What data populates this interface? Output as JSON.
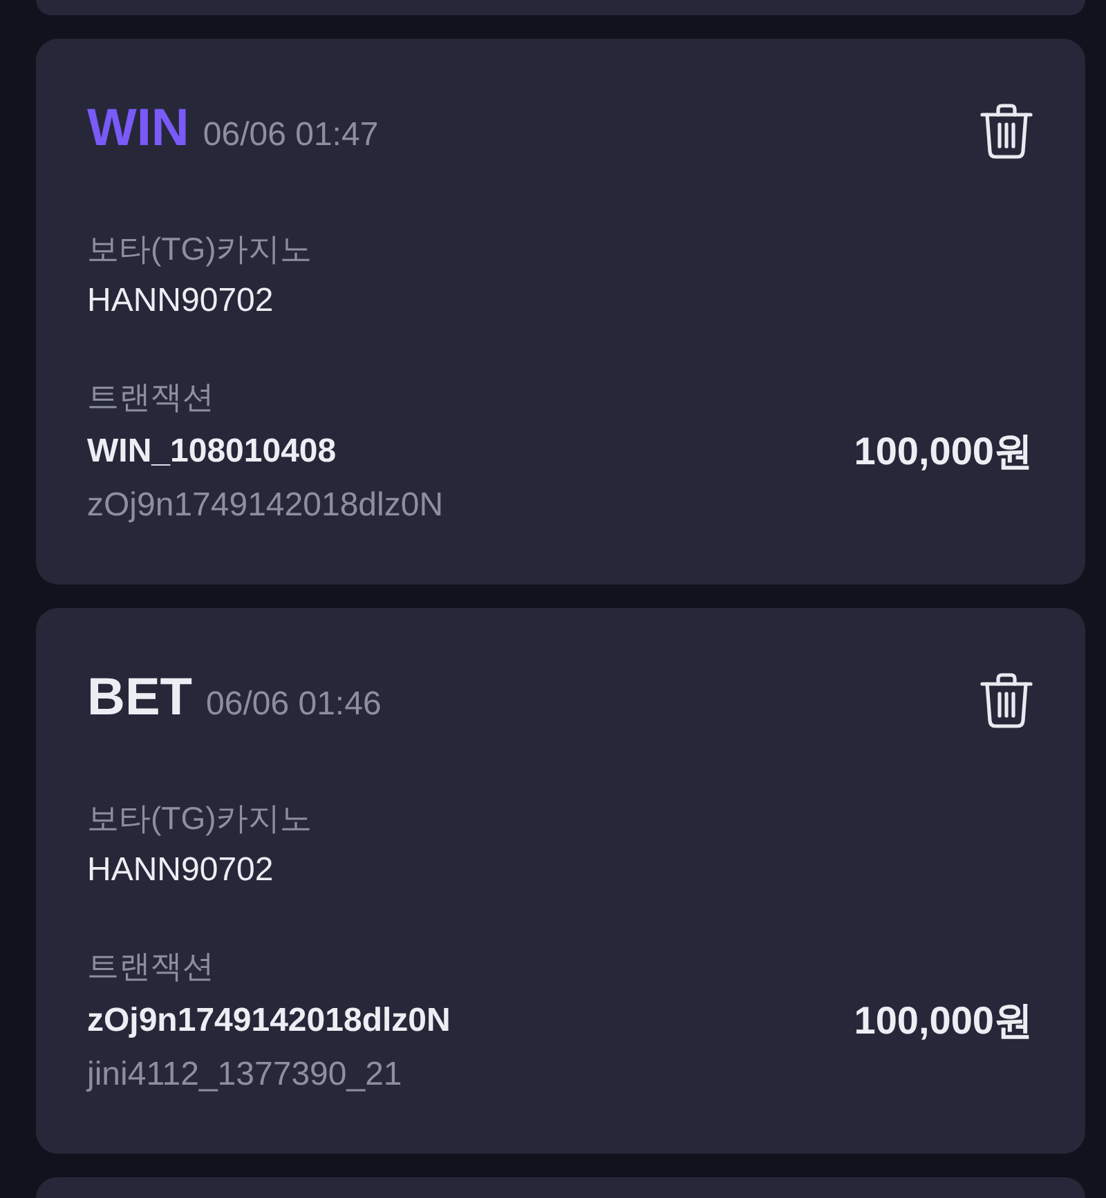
{
  "transactions": [
    {
      "kind": "win",
      "type": "WIN",
      "time": "06/06 01:47",
      "provider": "보타(TG)카지노",
      "user": "HANN90702",
      "transaction_label": "트랜잭션",
      "transaction_id": "WIN_108010408",
      "reference": "zOj9n1749142018dlz0N",
      "amount": "100,000원"
    },
    {
      "kind": "bet",
      "type": "BET",
      "time": "06/06 01:46",
      "provider": "보타(TG)카지노",
      "user": "HANN90702",
      "transaction_label": "트랜잭션",
      "transaction_id": "zOj9n1749142018dlz0N",
      "reference": "jini4112_1377390_21",
      "amount": "100,000원"
    }
  ]
}
